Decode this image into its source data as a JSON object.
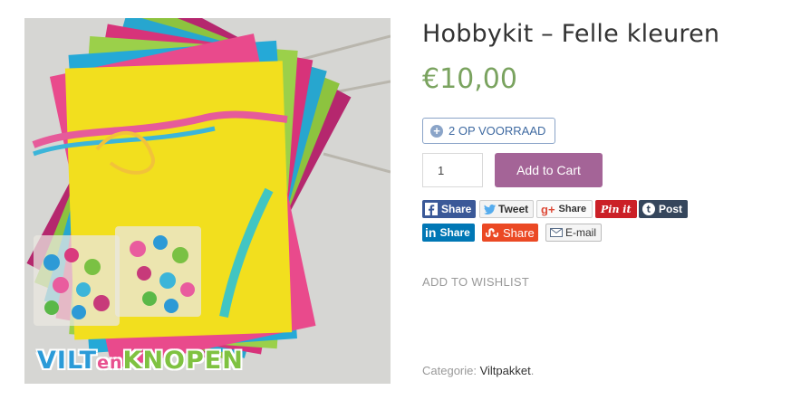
{
  "product": {
    "title": "Hobbykit – Felle kleuren",
    "price": "€10,00",
    "stock": "2 OP VOORRAAD",
    "quantity": "1",
    "add_to_cart": "Add to Cart",
    "brand": {
      "part1": "VILT",
      "part2": "en",
      "part3": "KNOPEN"
    }
  },
  "share": {
    "facebook": "Share",
    "twitter": "Tweet",
    "googleplus": "Share",
    "pinterest": "Pin it",
    "tumblr": "Post",
    "linkedin": "Share",
    "stumbleupon": "Share",
    "email": "E-mail"
  },
  "wishlist": "ADD TO WISHLIST",
  "meta": {
    "category_label": "Categorie: ",
    "category": "Viltpakket",
    "trailing": "."
  },
  "colors": {
    "price": "#7aa35f",
    "cart_button": "#a46497",
    "stock_border": "#8aa4c8"
  }
}
